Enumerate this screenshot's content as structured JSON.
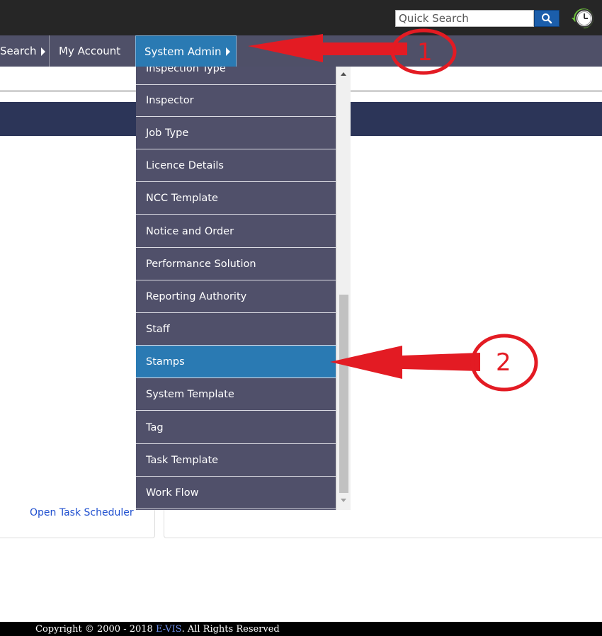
{
  "header": {
    "search": {
      "placeholder": "Quick Search",
      "value": ""
    },
    "search_icon": "search-icon",
    "clock_icon": "clock-icon"
  },
  "nav": {
    "items": [
      {
        "label": "Search"
      },
      {
        "label": "My Account"
      },
      {
        "label": "System Admin"
      }
    ]
  },
  "dropdown": {
    "items": [
      {
        "label": "Inspection Type"
      },
      {
        "label": "Inspector"
      },
      {
        "label": "Job Type"
      },
      {
        "label": "Licence Details"
      },
      {
        "label": "NCC Template"
      },
      {
        "label": "Notice and Order"
      },
      {
        "label": "Performance Solution"
      },
      {
        "label": "Reporting Authority"
      },
      {
        "label": "Staff"
      },
      {
        "label": "Stamps"
      },
      {
        "label": "System Template"
      },
      {
        "label": "Tag"
      },
      {
        "label": "Task Template"
      },
      {
        "label": "Work Flow"
      }
    ],
    "selected": "Stamps"
  },
  "main": {
    "task_link": "Open Task Scheduler"
  },
  "footer": {
    "prefix": "Copyright © 2000 - 2018 ",
    "brand": "E-VIS",
    "suffix": ". All Rights Reserved"
  },
  "annotations": {
    "one": "1",
    "two": "2",
    "color": "#e31b23"
  },
  "colors": {
    "nav_bg": "#4f5068",
    "active_blue": "#2a7ab3",
    "band_navy": "#2c3558",
    "topbar": "#262626"
  }
}
